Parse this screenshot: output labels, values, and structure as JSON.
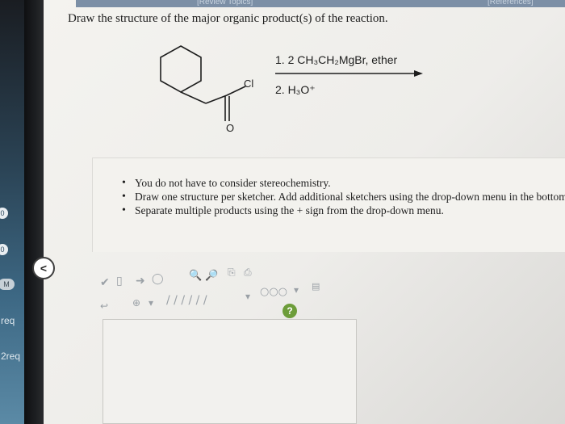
{
  "header": {
    "review_topics": "[Review Topics]",
    "references": "[References]"
  },
  "question": {
    "title": "Draw the structure of the major organic product(s) of the reaction."
  },
  "reaction": {
    "reagent_step1": "1. 2 CH₃CH₂MgBr, ether",
    "reagent_step2": "2. H₃O⁺",
    "atom_cl": "Cl",
    "atom_o": "O"
  },
  "instructions": [
    "You do not have to consider stereochemistry.",
    "Draw one structure per sketcher. Add additional sketchers using the drop-down menu in the bottom",
    "Separate multiple products using the + sign from the drop-down menu."
  ],
  "sidebar": {
    "labels": [
      "req",
      "2req"
    ],
    "badges": [
      "0",
      "0",
      "M"
    ]
  },
  "collapse_button": "<",
  "help_button": "?",
  "icons": {
    "collapse": "chevron-left-icon",
    "help": "help-icon",
    "toolbar": [
      "select-icon",
      "eraser-icon",
      "single-bond-icon",
      "lasso-icon",
      "zoom-in-icon",
      "zoom-out-icon",
      "copy-icon",
      "paste-icon",
      "bond-types-icon",
      "ring-icon",
      "charge-icon",
      "template-icon"
    ]
  },
  "colors": {
    "accent": "#6d9d3a",
    "topbar": "#7c8fa6"
  }
}
